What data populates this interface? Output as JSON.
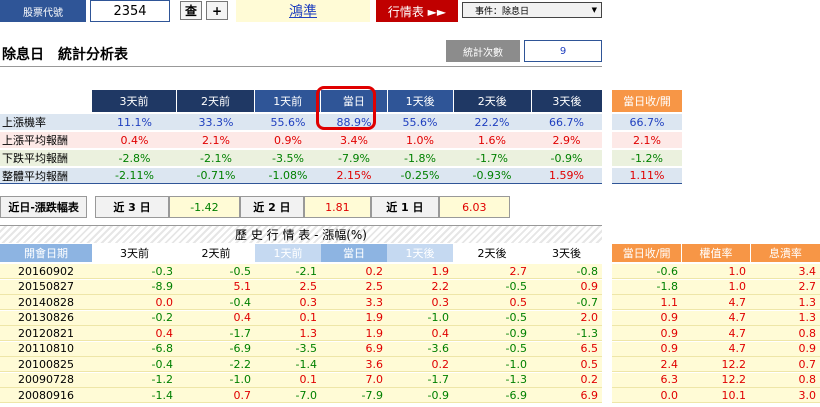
{
  "topbar": {
    "code_label": "股票代號",
    "code_value": "2354",
    "search_btn": "查",
    "add_btn": "+",
    "stock_name": "鴻準",
    "market_label": "行情表 ►►",
    "event_select": "事件：除息日"
  },
  "title": "除息日　統計分析表",
  "stat_count_label": "統計次數",
  "stat_count_value": "9",
  "stats": {
    "headers": [
      "3天前",
      "2天前",
      "1天前",
      "當日",
      "1天後",
      "2天後",
      "3天後"
    ],
    "side_header": "當日收/開",
    "rows": [
      {
        "label": "上漲機率",
        "values": [
          "11.1%",
          "33.3%",
          "55.6%",
          "88.9%",
          "55.6%",
          "22.2%",
          "66.7%"
        ],
        "side": "66.7%"
      },
      {
        "label": "上漲平均報酬",
        "values": [
          "0.4%",
          "2.1%",
          "0.9%",
          "3.4%",
          "1.0%",
          "1.6%",
          "2.9%"
        ],
        "side": "2.1%"
      },
      {
        "label": "下跌平均報酬",
        "values": [
          "-2.8%",
          "-2.1%",
          "-3.5%",
          "-7.9%",
          "-1.8%",
          "-1.7%",
          "-0.9%"
        ],
        "side": "-1.2%"
      },
      {
        "label": "整體平均報酬",
        "values": [
          "-2.11%",
          "-0.71%",
          "-1.08%",
          "2.15%",
          "-0.25%",
          "-0.93%",
          "1.59%"
        ],
        "side": "1.11%"
      }
    ]
  },
  "recent": {
    "label": "近日-漲跌幅表",
    "items": [
      {
        "label": "近 3 日",
        "value": "-1.42"
      },
      {
        "label": "近 2 日",
        "value": "1.81"
      },
      {
        "label": "近 1 日",
        "value": "6.03"
      }
    ]
  },
  "history": {
    "title": "歷 史 行 情 表 - 漲幅(%)",
    "headers": [
      "開會日期",
      "3天前",
      "2天前",
      "1天前",
      "當日",
      "1天後",
      "2天後",
      "3天後"
    ],
    "side_headers": [
      "當日收/開",
      "權值率",
      "息潰率"
    ],
    "rows": [
      {
        "date": "20160902",
        "v": [
          "-0.3",
          "-0.5",
          "-2.1",
          "0.2",
          "1.9",
          "2.7",
          "-0.8"
        ],
        "s": [
          "-0.6",
          "1.0",
          "3.4"
        ]
      },
      {
        "date": "20150827",
        "v": [
          "-8.9",
          "5.1",
          "2.5",
          "2.5",
          "2.2",
          "-0.5",
          "0.9"
        ],
        "s": [
          "-1.8",
          "1.0",
          "2.7"
        ]
      },
      {
        "date": "20140828",
        "v": [
          "0.0",
          "-0.4",
          "0.3",
          "3.3",
          "0.3",
          "0.5",
          "-0.7"
        ],
        "s": [
          "1.1",
          "4.7",
          "1.3"
        ]
      },
      {
        "date": "20130826",
        "v": [
          "-0.2",
          "0.4",
          "0.1",
          "1.9",
          "-1.0",
          "-0.5",
          "2.0"
        ],
        "s": [
          "0.9",
          "4.7",
          "1.3"
        ]
      },
      {
        "date": "20120821",
        "v": [
          "0.4",
          "-1.7",
          "1.3",
          "1.9",
          "0.4",
          "-0.9",
          "-1.3"
        ],
        "s": [
          "0.9",
          "4.7",
          "0.8"
        ]
      },
      {
        "date": "20110810",
        "v": [
          "-6.8",
          "-6.9",
          "-3.5",
          "6.9",
          "-3.6",
          "-0.5",
          "6.5"
        ],
        "s": [
          "0.9",
          "4.7",
          "0.9"
        ]
      },
      {
        "date": "20100825",
        "v": [
          "-0.4",
          "-2.2",
          "-1.4",
          "3.6",
          "0.2",
          "-1.0",
          "0.5"
        ],
        "s": [
          "2.4",
          "12.2",
          "0.7"
        ]
      },
      {
        "date": "20090728",
        "v": [
          "-1.2",
          "-1.0",
          "0.1",
          "7.0",
          "-1.7",
          "-1.3",
          "0.2"
        ],
        "s": [
          "6.3",
          "12.2",
          "0.8"
        ]
      },
      {
        "date": "20080916",
        "v": [
          "-1.4",
          "0.7",
          "-7.0",
          "-7.9",
          "-0.9",
          "-6.9",
          "6.9"
        ],
        "s": [
          "0.0",
          "10.1",
          "3.0"
        ]
      }
    ]
  },
  "colors": {
    "navy": "#1f3864",
    "blue": "#2f5597",
    "light_blue": "#8db4e2",
    "orange": "#f79646",
    "row_blue": "#dce6f1",
    "row_pink": "#fde9e7",
    "row_green": "#ebf1de",
    "row_yellow": "#fffbd6",
    "highlight": "#e00000"
  }
}
